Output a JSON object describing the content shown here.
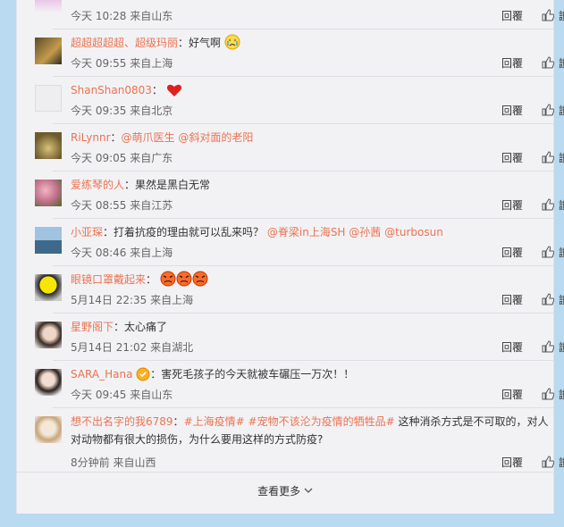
{
  "comments": [
    {
      "name": "",
      "text": "",
      "time": "今天 10:28 来自山东"
    },
    {
      "name": "超超超超超、超级玛丽",
      "sep": "：",
      "text": "好气啊",
      "time": "今天 09:55 来自上海"
    },
    {
      "name": "ShanShan0803",
      "sep": "：",
      "text": "",
      "time": "今天 09:35 来自北京"
    },
    {
      "name": "RiLynnr",
      "sep": "：",
      "mention1": "@萌爪医生",
      "mention2": "@斜对面的老阳",
      "time": "今天 09:05 来自广东"
    },
    {
      "name": "爱练琴的人",
      "sep": "：",
      "text": "果然是黑白无常",
      "time": "今天 08:55 来自江苏"
    },
    {
      "name": "小亚琛",
      "sep": "：",
      "text": "打着抗疫的理由就可以乱来吗？",
      "mention1": "@脊梁in上海SH",
      "mention2": "@孙茜",
      "mention3": "@turbosun",
      "time": "今天 08:46 来自上海"
    },
    {
      "name": "眼镜口罩戴起来",
      "sep": "：",
      "text": "",
      "time": "5月14日 22:35 来自上海"
    },
    {
      "name": "星野阁下",
      "sep": "：",
      "text": "太心痛了",
      "time": "5月14日 21:02 来自湖北"
    },
    {
      "name": "SARA_Hana",
      "sep": "：",
      "text": "害死毛孩子的今天就被车碾压一万次！！",
      "time": "今天 09:45 来自山东"
    },
    {
      "name": "想不出名字的我6789",
      "sep": "：",
      "tag1": "#上海疫情#",
      "tag2": "#宠物不该沦为疫情的牺牲品#",
      "text": " 这种消杀方式是不可取的，对人",
      "text2": "对动物都有很大的损伤，为什么要用这样的方式防疫?",
      "time": "8分钟前 来自山西"
    }
  ],
  "actions": {
    "reply": "回覆",
    "like": "讃"
  },
  "more": {
    "label": "查看更多",
    "arrow": "⌄"
  },
  "colors": {
    "link": "#eb7350",
    "page_bg": "#b9daf0",
    "panel_bg": "#f2f2f5"
  }
}
